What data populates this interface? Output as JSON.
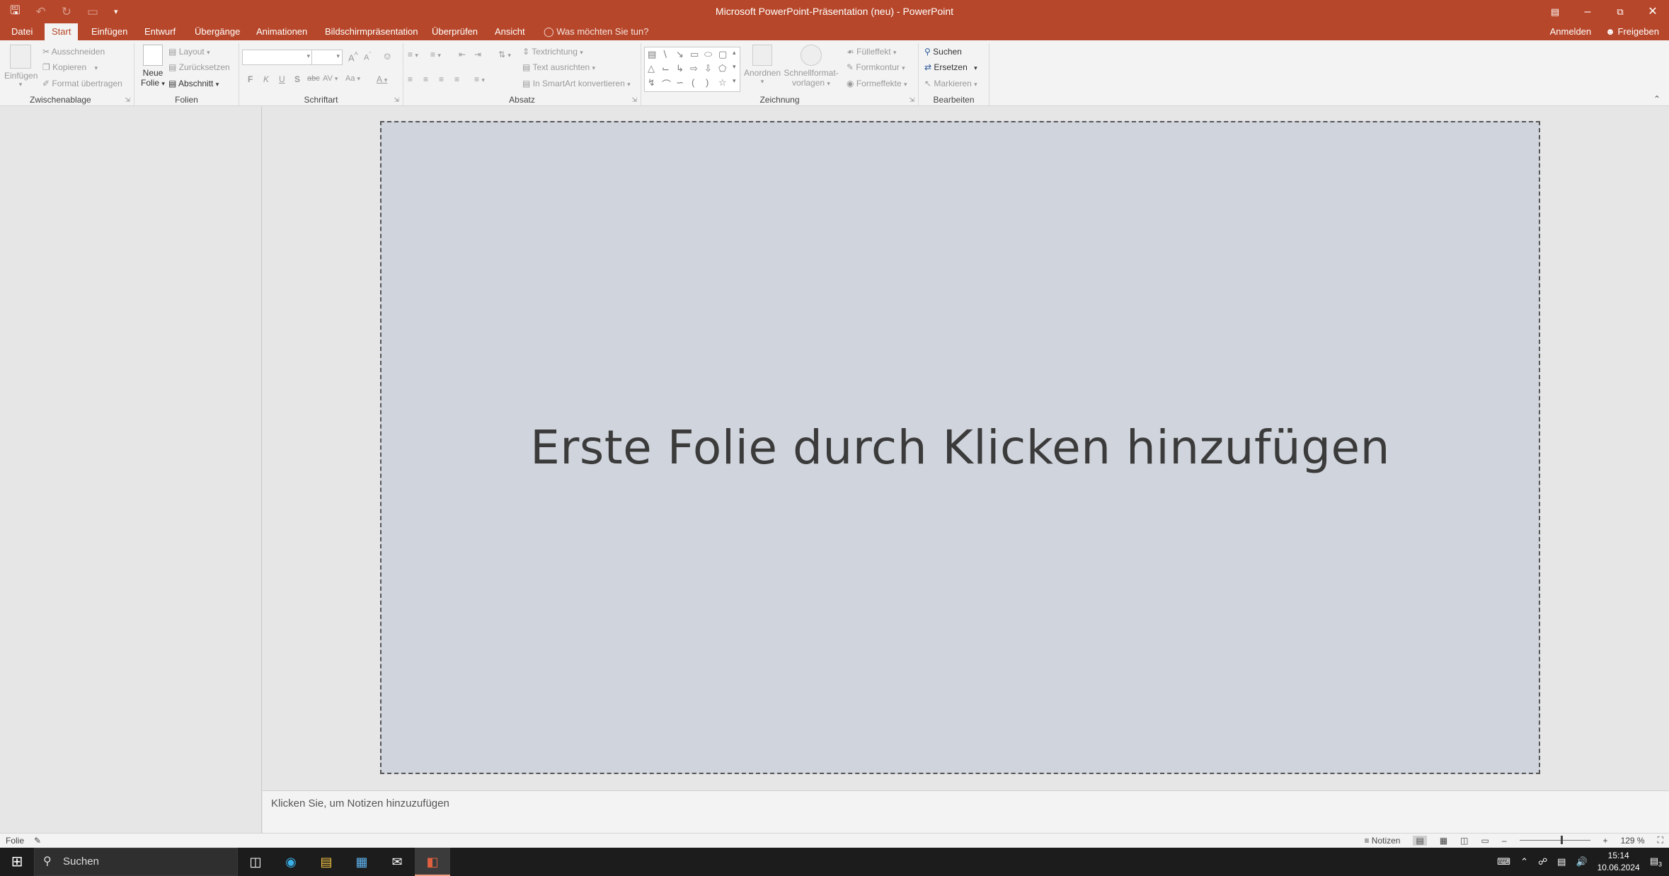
{
  "titlebar": {
    "title": "Microsoft PowerPoint-Präsentation (neu) - PowerPoint",
    "qat_icons": [
      "save-icon",
      "undo-icon",
      "redo-icon",
      "start-from-beginning-icon",
      "customize-qat-icon"
    ],
    "window_buttons": [
      "ribbon-display-options-icon",
      "minimize-icon",
      "restore-icon",
      "close-icon"
    ]
  },
  "tabs": [
    {
      "label": "Datei",
      "active": false
    },
    {
      "label": "Start",
      "active": true
    },
    {
      "label": "Einfügen",
      "active": false
    },
    {
      "label": "Entwurf",
      "active": false
    },
    {
      "label": "Übergänge",
      "active": false
    },
    {
      "label": "Animationen",
      "active": false
    },
    {
      "label": "Bildschirmpräsentation",
      "active": false
    },
    {
      "label": "Überprüfen",
      "active": false
    },
    {
      "label": "Ansicht",
      "active": false
    }
  ],
  "tell_me": "Was möchten Sie tun?",
  "account": {
    "sign_in": "Anmelden",
    "share": "Freigeben"
  },
  "ribbon": {
    "clipboard": {
      "group": "Zwischenablage",
      "paste": "Einfügen",
      "cut": "Ausschneiden",
      "copy": "Kopieren",
      "format_painter": "Format übertragen"
    },
    "slides": {
      "group": "Folien",
      "new_slide_line1": "Neue",
      "new_slide_line2": "Folie",
      "layout": "Layout",
      "reset": "Zurücksetzen",
      "section": "Abschnitt"
    },
    "font": {
      "group": "Schriftart",
      "bold": "F",
      "italic": "K",
      "underline": "U",
      "shadow": "S",
      "strike": "abc",
      "char_spacing": "AV",
      "change_case": "Aa",
      "font_color": "A",
      "grow": "A",
      "shrink": "A"
    },
    "paragraph": {
      "group": "Absatz",
      "text_direction": "Textrichtung",
      "align_text": "Text ausrichten",
      "smartart": "In SmartArt konvertieren"
    },
    "drawing": {
      "group": "Zeichnung",
      "arrange": "Anordnen",
      "quick_styles_line1": "Schnellformat-",
      "quick_styles_line2": "vorlagen",
      "fill": "Fülleffekt",
      "outline": "Formkontur",
      "effects": "Formeffekte"
    },
    "editing": {
      "group": "Bearbeiten",
      "find": "Suchen",
      "replace": "Ersetzen",
      "select": "Markieren"
    }
  },
  "slide": {
    "prompt": "Erste Folie durch Klicken hinzufügen"
  },
  "notes": {
    "placeholder": "Klicken Sie, um Notizen hinzuzufügen"
  },
  "statusbar": {
    "slide_label": "Folie",
    "notes_button": "Notizen",
    "zoom": "129 %"
  },
  "taskbar": {
    "search_label": "Suchen",
    "time": "15:14",
    "date": "10.06.2024",
    "notification_count": "3"
  },
  "colors": {
    "accent": "#b7472a",
    "slide_background": "#d0d4dc",
    "app_background": "#e6e6e6"
  }
}
